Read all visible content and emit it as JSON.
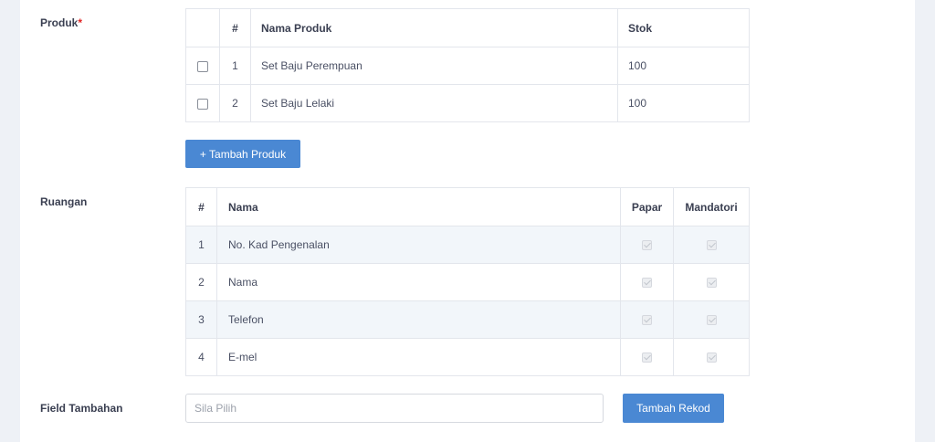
{
  "produk": {
    "label": "Produk",
    "required_mark": "*",
    "headers": {
      "num": "#",
      "name": "Nama Produk",
      "stock": "Stok"
    },
    "rows": [
      {
        "num": "1",
        "name": "Set Baju Perempuan",
        "stock": "100"
      },
      {
        "num": "2",
        "name": "Set Baju Lelaki",
        "stock": "100"
      }
    ],
    "add_button": "+ Tambah Produk"
  },
  "ruangan": {
    "label": "Ruangan",
    "headers": {
      "num": "#",
      "name": "Nama",
      "show": "Papar",
      "mandatory": "Mandatori"
    },
    "rows": [
      {
        "num": "1",
        "name": "No. Kad Pengenalan"
      },
      {
        "num": "2",
        "name": "Nama"
      },
      {
        "num": "3",
        "name": "Telefon"
      },
      {
        "num": "4",
        "name": "E-mel"
      }
    ]
  },
  "field_tambahan": {
    "label": "Field Tambahan",
    "placeholder": "Sila Pilih",
    "add_button": "Tambah Rekod"
  },
  "colors": {
    "accent": "#4a88d3",
    "page_bg": "#eef1f6",
    "stripe": "#f2f6fa"
  }
}
